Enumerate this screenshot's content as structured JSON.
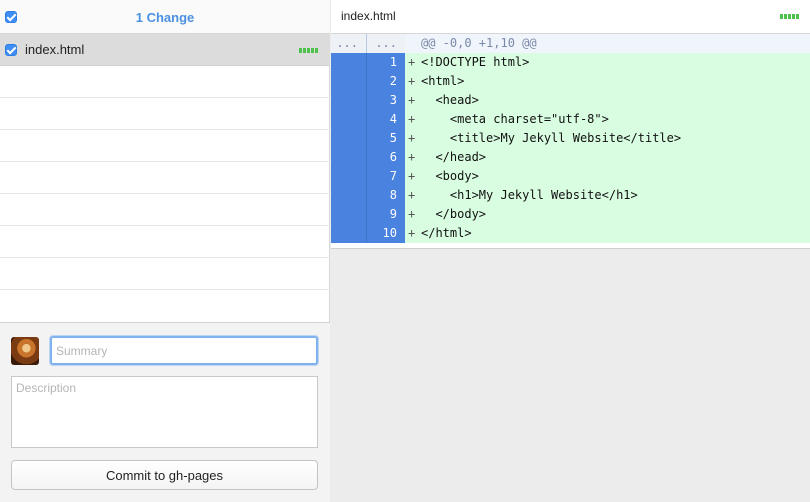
{
  "changes": {
    "title": "1 Change",
    "files": [
      {
        "name": "index.html"
      }
    ]
  },
  "commit": {
    "summary_placeholder": "Summary",
    "description_placeholder": "Description",
    "button_label": "Commit to gh-pages"
  },
  "diff": {
    "filename": "index.html",
    "hunk_old": "...",
    "hunk_new": "...",
    "hunk_header": "@@ -0,0 +1,10 @@",
    "lines": [
      {
        "num": "1",
        "sign": "+",
        "code": "<!DOCTYPE html>"
      },
      {
        "num": "2",
        "sign": "+",
        "code": "<html>"
      },
      {
        "num": "3",
        "sign": "+",
        "code": "  <head>"
      },
      {
        "num": "4",
        "sign": "+",
        "code": "    <meta charset=\"utf-8\">"
      },
      {
        "num": "5",
        "sign": "+",
        "code": "    <title>My Jekyll Website</title>"
      },
      {
        "num": "6",
        "sign": "+",
        "code": "  </head>"
      },
      {
        "num": "7",
        "sign": "+",
        "code": "  <body>"
      },
      {
        "num": "8",
        "sign": "+",
        "code": "    <h1>My Jekyll Website</h1>"
      },
      {
        "num": "9",
        "sign": "+",
        "code": "  </body>"
      },
      {
        "num": "10",
        "sign": "+",
        "code": "</html>"
      }
    ]
  },
  "colors": {
    "accent": "#4a90e2",
    "added_bg": "#d9fde1",
    "gutter_added": "#4a82e0",
    "diffstat_green": "#4cc24c"
  }
}
